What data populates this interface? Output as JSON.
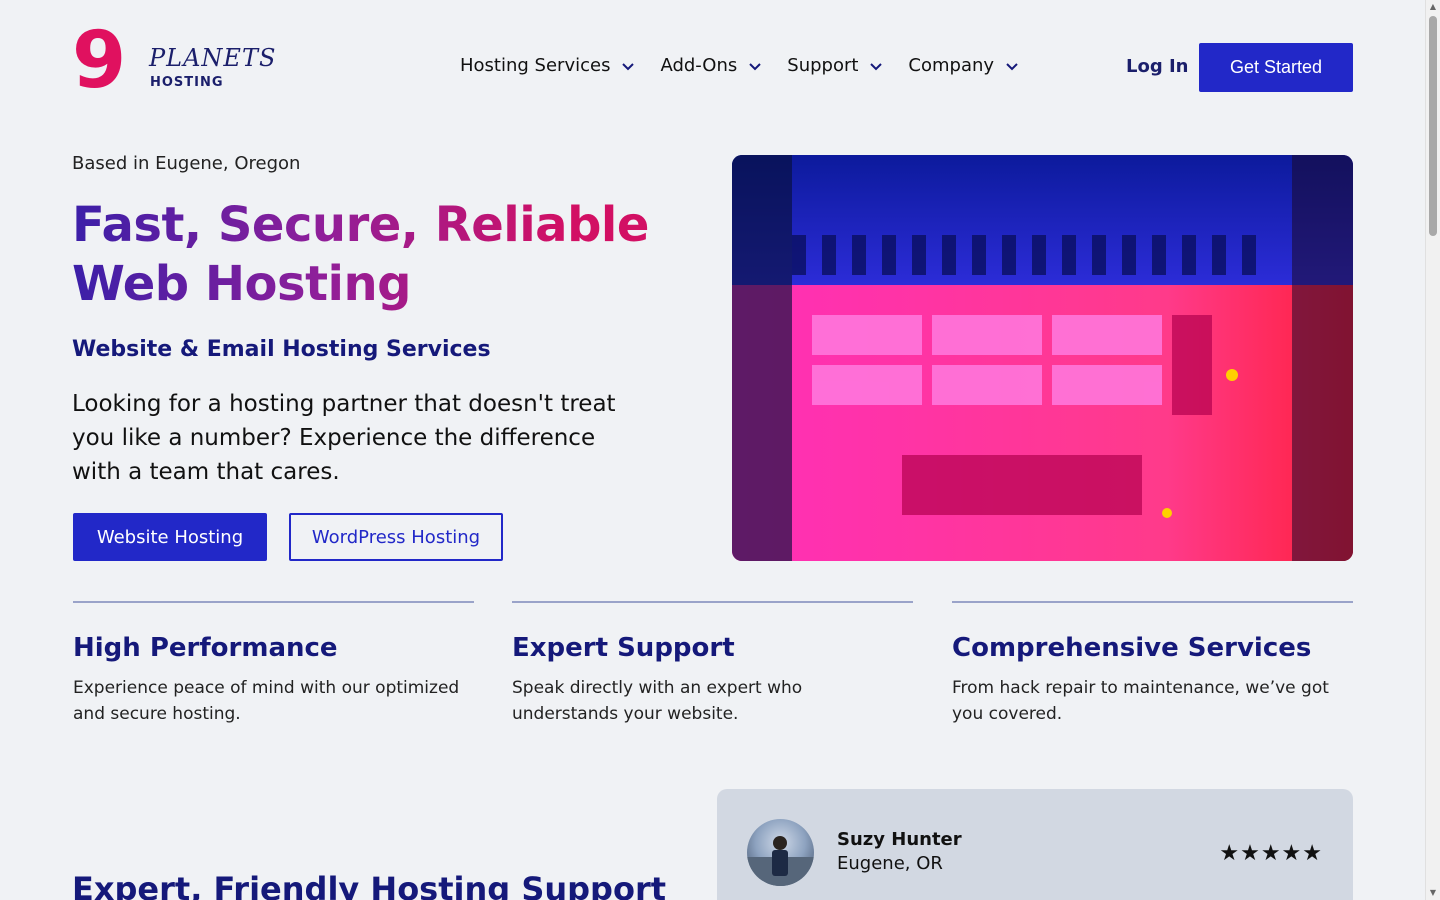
{
  "brand": {
    "logo_mark": "9",
    "logo_word_top": "PLANETS",
    "logo_word_bottom": "HOSTING",
    "accent_pink": "#e0115f",
    "navy": "#15197a",
    "blue": "#2228c8"
  },
  "nav": {
    "items": [
      {
        "label": "Hosting Services",
        "icon": "chevron-down-icon"
      },
      {
        "label": "Add-Ons",
        "icon": "chevron-down-icon"
      },
      {
        "label": "Support",
        "icon": "chevron-down-icon"
      },
      {
        "label": "Company",
        "icon": "chevron-down-icon"
      }
    ],
    "login": "Log In",
    "cta": "Get Started"
  },
  "hero": {
    "location": "Based in Eugene, Oregon",
    "headline_line1": "Fast, Secure, Reliable",
    "headline_line2": "Web Hosting",
    "subheading": "Website & Email Hosting Services",
    "body": "Looking for a hosting partner that doesn't treat you like a number? Experience the difference with a team that cares.",
    "primary_button": "Website Hosting",
    "secondary_button": "WordPress Hosting",
    "image": "server-rack-photo"
  },
  "features": [
    {
      "title": "High Performance",
      "text": "Experience peace of mind with our optimized and secure hosting."
    },
    {
      "title": "Expert Support",
      "text": "Speak directly with an expert who understands your website."
    },
    {
      "title": "Comprehensive Services",
      "text": "From hack repair to maintenance, we’ve got you covered."
    }
  ],
  "support_section": {
    "title": "Expert, Friendly Hosting Support"
  },
  "review": {
    "name": "Suzy Hunter",
    "location": "Eugene, OR",
    "stars": "★★★★★",
    "rating": 5
  }
}
